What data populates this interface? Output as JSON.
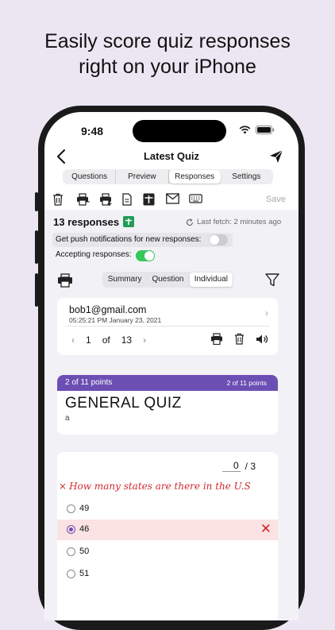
{
  "promo": {
    "headline_line1": "Easily score quiz responses",
    "headline_line2": "right on your iPhone"
  },
  "status_bar": {
    "time": "9:48"
  },
  "nav": {
    "title": "Latest Quiz"
  },
  "tabs": [
    {
      "label": "Questions",
      "active": false
    },
    {
      "label": "Preview",
      "active": false
    },
    {
      "label": "Responses",
      "active": true
    },
    {
      "label": "Settings",
      "active": false
    }
  ],
  "toolbar": {
    "save_label": "Save"
  },
  "responses": {
    "count_label": "13 responses",
    "last_fetch": "Last fetch: 2 minutes ago",
    "push_label": "Get push notifications for new responses:",
    "push_enabled": false,
    "accepting_label": "Accepting responses:",
    "accepting_enabled": true
  },
  "view_tabs": [
    {
      "label": "Summary",
      "active": false
    },
    {
      "label": "Question",
      "active": false
    },
    {
      "label": "Individual",
      "active": true
    }
  ],
  "respondent": {
    "email": "bob1@gmail.com",
    "timestamp": "05:25:21 PM  January 23, 2021",
    "page_current": "1",
    "page_of": "of",
    "page_total": "13"
  },
  "quiz": {
    "points_left": "2 of 11 points",
    "points_right": "2 of 11 points",
    "title": "GENERAL QUIZ",
    "description": "a"
  },
  "question": {
    "score": "0",
    "score_total": "/ 3",
    "text": "How many states are there in the U.S",
    "options": [
      {
        "label": "49",
        "selected": false,
        "wrong": false
      },
      {
        "label": "46",
        "selected": true,
        "wrong": true
      },
      {
        "label": "50",
        "selected": false,
        "wrong": false
      },
      {
        "label": "51",
        "selected": false,
        "wrong": false
      }
    ]
  },
  "colors": {
    "background": "#ece6f3",
    "accent": "#6c4fb3",
    "wrong": "#d0292e",
    "toggle_on": "#34c759",
    "sheets_green": "#1f9d55"
  }
}
